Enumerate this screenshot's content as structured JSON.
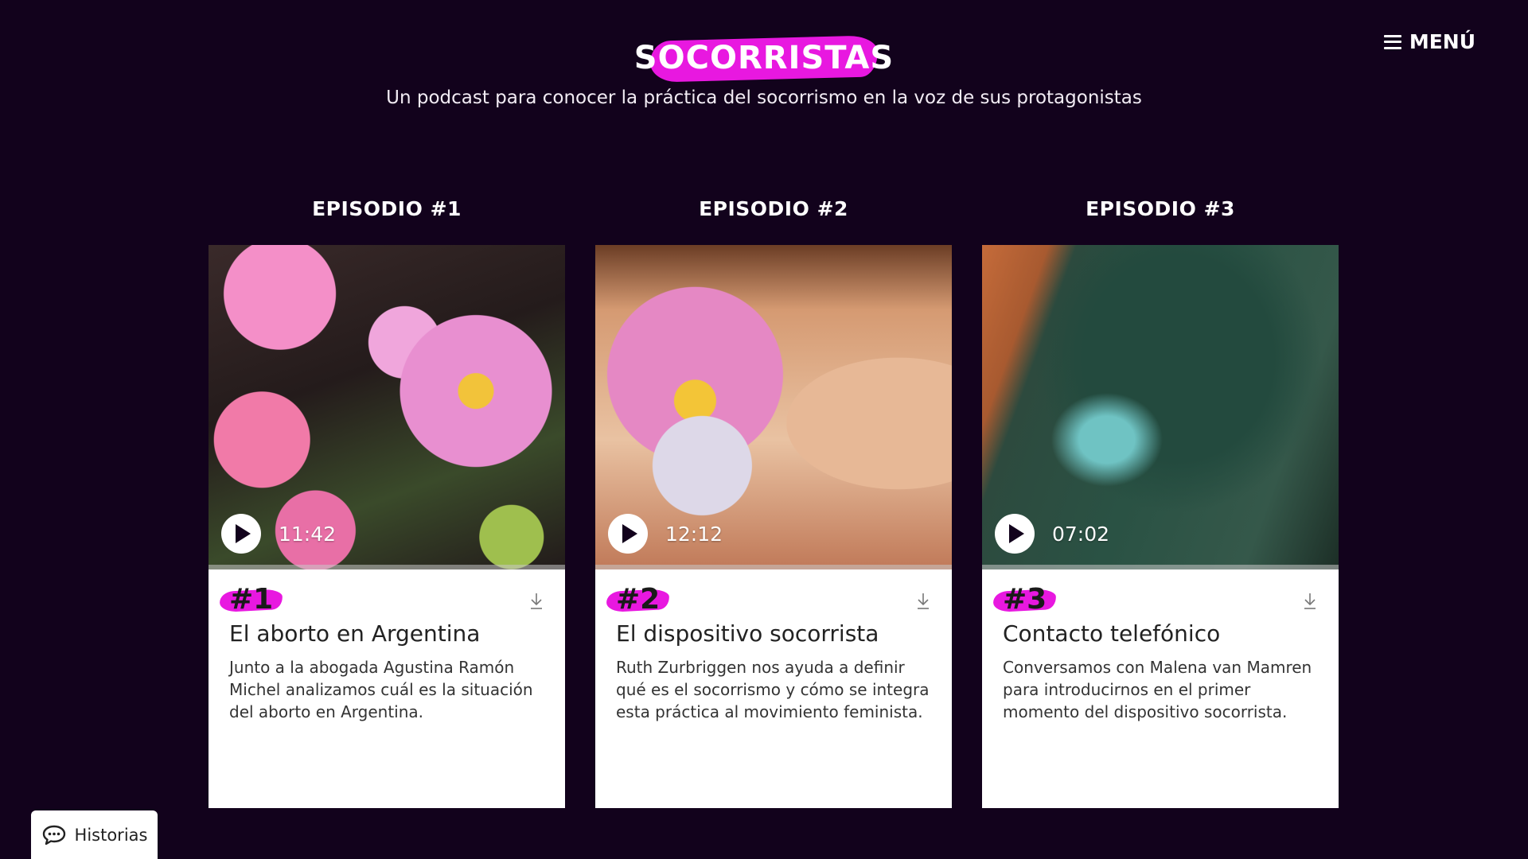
{
  "header": {
    "brand": "SOCORRISTAS",
    "tagline": "Un podcast para conocer la práctica del socorrismo en la voz de sus protagonistas",
    "menu_label": "MENÚ"
  },
  "episodes": [
    {
      "heading": "EPISODIO #1",
      "number": "#1",
      "duration": "11:42",
      "title": "El aborto en Argentina",
      "description": "Junto a la abogada Agustina Ramón Michel analizamos cuál es la situación del aborto en Argentina."
    },
    {
      "heading": "EPISODIO #2",
      "number": "#2",
      "duration": "12:12",
      "title": "El dispositivo socorrista",
      "description": "Ruth Zurbriggen nos ayuda a definir qué es el socorrismo y cómo se integra esta práctica al movimiento feminista."
    },
    {
      "heading": "EPISODIO #3",
      "number": "#3",
      "duration": "07:02",
      "title": "Contacto telefónico",
      "description": "Conversamos con Malena van Mamren para introducirnos en el primer momento del dispositivo socorrista."
    }
  ],
  "stories_tab": {
    "label": "Historias",
    "icon": "chat-bubble-icon"
  },
  "colors": {
    "background": "#12021c",
    "accent": "#e818e0",
    "card": "#ffffff"
  },
  "icons": {
    "menu": "hamburger-icon",
    "play": "play-icon",
    "download": "download-icon"
  }
}
